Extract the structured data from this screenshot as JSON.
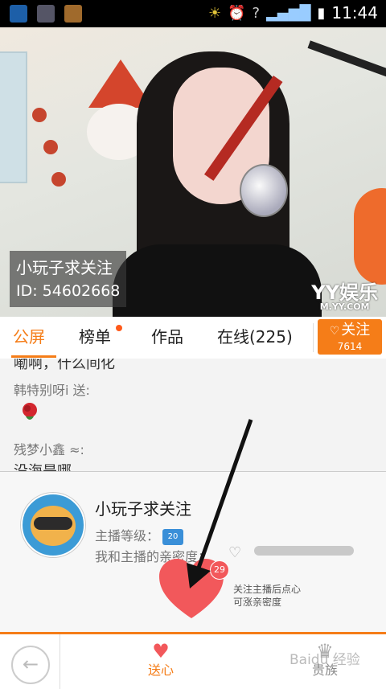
{
  "status_bar": {
    "time": "11:44"
  },
  "stream": {
    "host_name": "小玩子求关注",
    "host_id": "ID: 54602668",
    "logo_main": "YY娱乐",
    "logo_url": "M.YY.COM"
  },
  "tabs": [
    {
      "label": "公屏",
      "active": true
    },
    {
      "label": "榜单",
      "has_dot": true
    },
    {
      "label": "作品"
    },
    {
      "label": "在线(225)"
    }
  ],
  "follow_button": {
    "label": "关注",
    "count": "7614"
  },
  "chat": {
    "messages": [
      {
        "text": "嘞啊，什么间化"
      },
      {
        "user": "韩特别呀i 送:"
      },
      {
        "user": "残梦小鑫 ≈:"
      },
      {
        "text": "没海是哪"
      }
    ]
  },
  "host_card": {
    "name": "小玩子求关注",
    "level_label": "主播等级：",
    "level_value": "20",
    "intimacy_label": "我和主播的亲密度：",
    "heart_count": "29",
    "tip_line1": "关注主播后点心",
    "tip_line2": "可涨亲密度"
  },
  "bottom_bar": {
    "send_heart_label": "送心",
    "noble_label": "贵族"
  },
  "watermark": "Baidu 经验",
  "colors": {
    "accent": "#f57d18",
    "heart": "#f2585b"
  }
}
